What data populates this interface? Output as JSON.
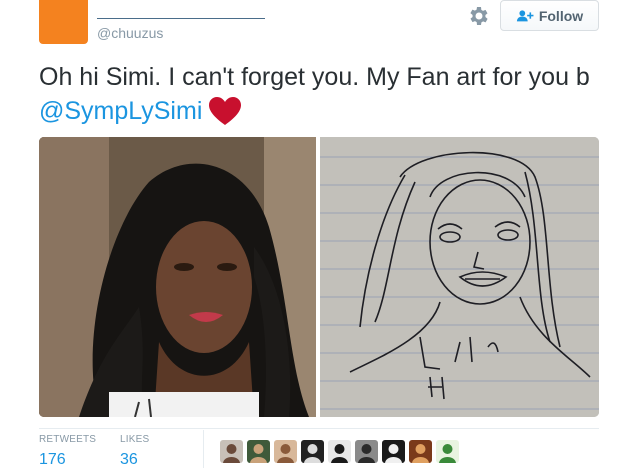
{
  "user": {
    "handle": "@chuuzus",
    "avatar_color": "#f4821f"
  },
  "actions": {
    "settings_icon": "gear-icon",
    "follow_label": "Follow"
  },
  "tweet": {
    "text_before": "Oh hi Simi. I can't forget you. My Fan art for you b ",
    "mention": "@SympLySimi",
    "emoji": "red-heart-icon",
    "mention_color": "#1b95e0"
  },
  "media": [
    {
      "name": "photo-of-simi",
      "kind": "photo"
    },
    {
      "name": "fan-art-sketch",
      "kind": "drawing"
    }
  ],
  "stats": {
    "retweets_label": "RETWEETS",
    "retweets_value": "176",
    "likes_label": "LIKES",
    "likes_value": "36"
  },
  "likers": [
    {
      "bg": "#c8c0b8",
      "fg": "#6a4a3a"
    },
    {
      "bg": "#3f5a3a",
      "fg": "#c9a27a"
    },
    {
      "bg": "#d8b89a",
      "fg": "#8a5a3a"
    },
    {
      "bg": "#222222",
      "fg": "#dddddd"
    },
    {
      "bg": "#e8e8e8",
      "fg": "#1a1a1a"
    },
    {
      "bg": "#8a8a8a",
      "fg": "#2a2a2a"
    },
    {
      "bg": "#1a1a1a",
      "fg": "#f0f0f0"
    },
    {
      "bg": "#7a3a1a",
      "fg": "#e0a060"
    },
    {
      "bg": "#e8f4e0",
      "fg": "#3a8a3a"
    }
  ]
}
